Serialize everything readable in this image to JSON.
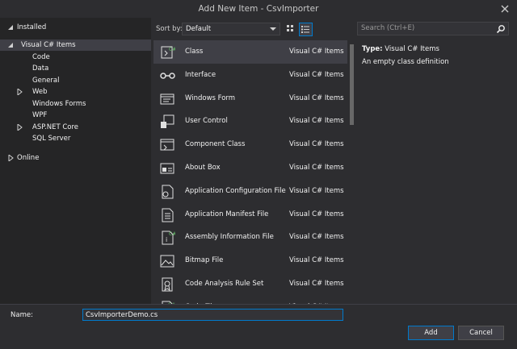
{
  "window": {
    "title": "Add New Item - CsvImporter"
  },
  "tree": {
    "installed": "Installed",
    "items": [
      {
        "label": "Visual C# Items",
        "level": 1,
        "expander": "expanded",
        "selected": true
      },
      {
        "label": "Code",
        "level": 2,
        "expander": "none"
      },
      {
        "label": "Data",
        "level": 2,
        "expander": "none"
      },
      {
        "label": "General",
        "level": 2,
        "expander": "none"
      },
      {
        "label": "Web",
        "level": 2,
        "expander": "collapsed"
      },
      {
        "label": "Windows Forms",
        "level": 2,
        "expander": "none"
      },
      {
        "label": "WPF",
        "level": 2,
        "expander": "none"
      },
      {
        "label": "ASP.NET Core",
        "level": 2,
        "expander": "collapsed"
      },
      {
        "label": "SQL Server",
        "level": 2,
        "expander": "none"
      }
    ],
    "online": "Online"
  },
  "toolbar": {
    "sort_label": "Sort by:",
    "sort_value": "Default",
    "search_placeholder": "Search (Ctrl+E)"
  },
  "templates": [
    {
      "name": "Class",
      "category": "Visual C# Items",
      "icon": "class-icon",
      "selected": true
    },
    {
      "name": "Interface",
      "category": "Visual C# Items",
      "icon": "interface-icon"
    },
    {
      "name": "Windows Form",
      "category": "Visual C# Items",
      "icon": "windows-form-icon"
    },
    {
      "name": "User Control",
      "category": "Visual C# Items",
      "icon": "user-control-icon"
    },
    {
      "name": "Component Class",
      "category": "Visual C# Items",
      "icon": "component-class-icon"
    },
    {
      "name": "About Box",
      "category": "Visual C# Items",
      "icon": "about-box-icon"
    },
    {
      "name": "Application Configuration File",
      "category": "Visual C# Items",
      "icon": "config-file-icon"
    },
    {
      "name": "Application Manifest File",
      "category": "Visual C# Items",
      "icon": "manifest-file-icon"
    },
    {
      "name": "Assembly Information File",
      "category": "Visual C# Items",
      "icon": "assembly-info-icon"
    },
    {
      "name": "Bitmap File",
      "category": "Visual C# Items",
      "icon": "bitmap-file-icon"
    },
    {
      "name": "Code Analysis Rule Set",
      "category": "Visual C# Items",
      "icon": "rule-set-icon"
    },
    {
      "name": "Code File",
      "category": "Visual C# Items",
      "icon": "code-file-icon"
    }
  ],
  "details": {
    "type_label": "Type:",
    "type_value": "Visual C# Items",
    "description": "An empty class definition"
  },
  "footer": {
    "name_label": "Name:",
    "name_value": "CsvImporterDemo.cs",
    "add_label": "Add",
    "cancel_label": "Cancel"
  },
  "colors": {
    "accent": "#007acc",
    "background": "#2d2d30",
    "panel": "#252526",
    "selection": "#3f3f46"
  }
}
